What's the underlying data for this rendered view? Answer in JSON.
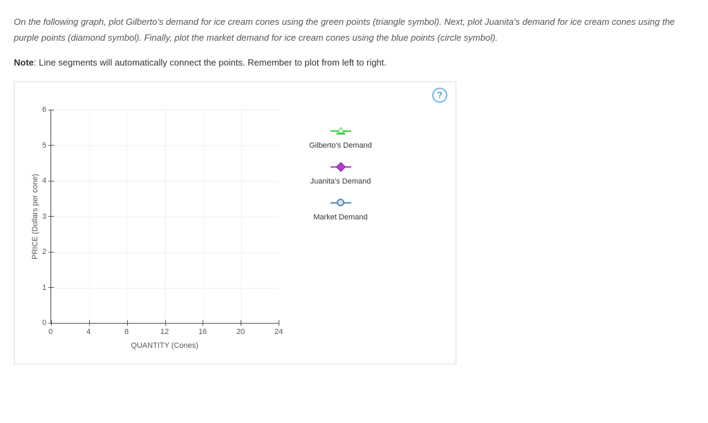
{
  "instructions": {
    "paragraph1": "On the following graph, plot Gilberto's demand for ice cream cones using the green points (triangle symbol). Next, plot Juanita's demand for ice cream cones using the purple points (diamond symbol). Finally, plot the market demand for ice cream cones using the blue points (circle symbol)."
  },
  "note": {
    "prefix": "Note",
    "text": ": Line segments will automatically connect the points. Remember to plot from left to right."
  },
  "help": {
    "label": "?"
  },
  "chart_data": {
    "type": "line",
    "title": "",
    "xlabel": "QUANTITY (Cones)",
    "ylabel": "PRICE (Dollars per cone)",
    "xlim": [
      0,
      24
    ],
    "ylim": [
      0,
      6
    ],
    "x_ticks": [
      0,
      4,
      8,
      12,
      16,
      20,
      24
    ],
    "y_ticks": [
      0,
      1,
      2,
      3,
      4,
      5,
      6
    ],
    "series": [
      {
        "name": "Gilberto's Demand",
        "symbol": "triangle",
        "color": "#3dd13d",
        "x": [],
        "y": []
      },
      {
        "name": "Juanita's Demand",
        "symbol": "diamond",
        "color": "#b040d0",
        "x": [],
        "y": []
      },
      {
        "name": "Market Demand",
        "symbol": "circle",
        "color": "#5a8ab0",
        "x": [],
        "y": []
      }
    ]
  }
}
